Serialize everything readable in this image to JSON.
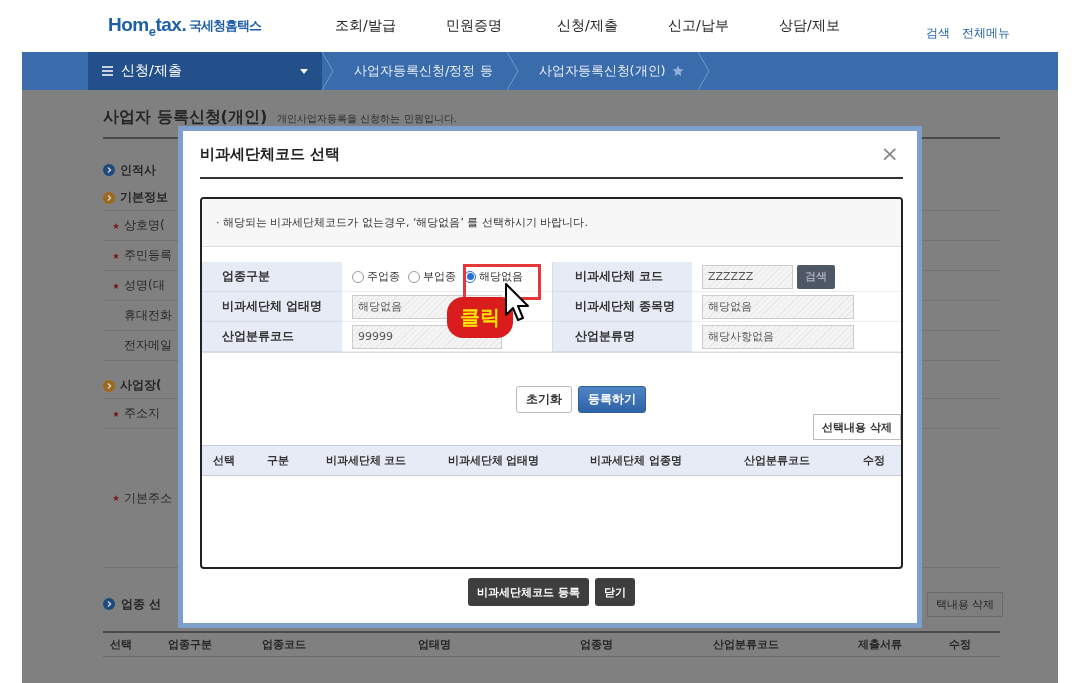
{
  "header": {
    "logo": "Hom$_{e}$tax.",
    "logo_subtitle": "국세청홈택스",
    "nav": [
      "조회/발급",
      "민원증명",
      "신청/제출",
      "신고/납부",
      "상담/제보"
    ],
    "utility_links": [
      "검색",
      "전체메뉴"
    ]
  },
  "menu_bar": {
    "menu": "신청/제출",
    "breadcrumbs": [
      "사업자등록신청/정정 등",
      "사업자등록신청(개인)"
    ]
  },
  "background_page": {
    "title": "사업자 등록신청(개인)",
    "subtitle": "개인사업자등록을 신청하는 민원입니다.",
    "side_items": [
      {
        "kind": "section",
        "label": "인적사"
      },
      {
        "kind": "group",
        "label": "기본정보"
      },
      {
        "kind": "field",
        "label": "상호명(",
        "required": true
      },
      {
        "kind": "field",
        "label": "주민등록",
        "required": true
      },
      {
        "kind": "field",
        "label": "성명(대",
        "required": true
      },
      {
        "kind": "field",
        "label": "휴대전화",
        "required": false
      },
      {
        "kind": "field",
        "label": "전자메일",
        "required": false
      },
      {
        "kind": "group",
        "label": "사업장("
      },
      {
        "kind": "field",
        "label": "주소지",
        "required": true
      },
      {
        "kind": "tall",
        "label": "기본주소",
        "required": true
      }
    ],
    "section2": {
      "label": "업종 선",
      "button": "택내용 삭제"
    },
    "table_columns": [
      "선택",
      "업종구분",
      "업종코드",
      "업태명",
      "업종명",
      "산업분류코드",
      "제출서류",
      "수정"
    ]
  },
  "dialog": {
    "title": "비과세단체코드 선택",
    "close": "×",
    "notice_bullet": "·",
    "notice": "해당되는 비과세단체코드가 없는경우, ‘해당없음’ 를 선택하시기 바랍니다.",
    "fields": [
      {
        "kind": "radios",
        "label": "업종구분",
        "options": [
          {
            "label": "주업종",
            "selected": false
          },
          {
            "label": "부업종",
            "selected": false
          },
          {
            "label": "해당없음",
            "selected": true
          }
        ]
      },
      {
        "kind": "search",
        "label": "비과세단체 코드",
        "value": "ZZZZZZ",
        "button": "검색"
      },
      {
        "kind": "text",
        "label": "비과세단체 업태명",
        "value": "해당없음"
      },
      {
        "kind": "text",
        "label": "비과세단체 종목명",
        "value": "해당없음"
      },
      {
        "kind": "text",
        "label": "산업분류코드",
        "value": "99999"
      },
      {
        "kind": "text",
        "label": "산업분류명",
        "value": "해당사항없음"
      }
    ],
    "form_buttons": [
      {
        "label": "초기화",
        "primary": false
      },
      {
        "label": "등록하기",
        "primary": true
      }
    ],
    "delete_button": "선택내용 삭제",
    "table_columns": [
      "선택",
      "구분",
      "비과세단체 코드",
      "비과세단체 업태명",
      "비과세단체 업종명",
      "산업분류코드",
      "수정"
    ],
    "footer_buttons": [
      "비과세단체코드 등록",
      "닫기"
    ],
    "callout": "클릭"
  }
}
